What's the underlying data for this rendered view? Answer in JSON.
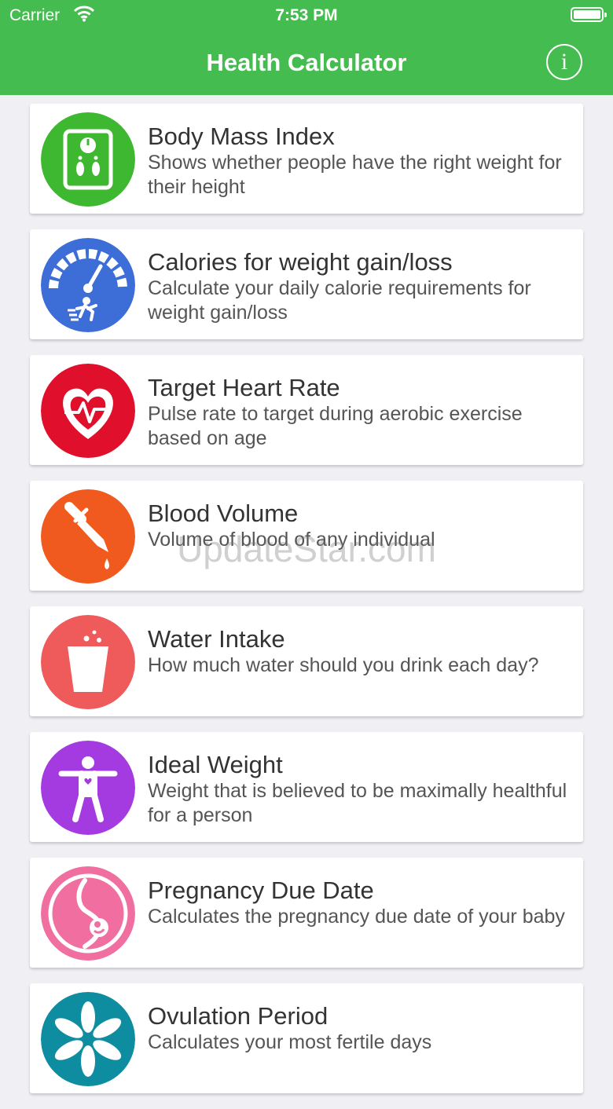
{
  "status": {
    "carrier": "Carrier",
    "time": "7:53 PM"
  },
  "header": {
    "title": "Health Calculator",
    "info_label": "i"
  },
  "items": [
    {
      "title": "Body Mass Index",
      "description": "Shows whether people have the right weight for their height",
      "color": "#3eb830",
      "icon": "scale-icon"
    },
    {
      "title": "Calories for weight gain/loss",
      "description": "Calculate your daily calorie requirements for weight gain/loss",
      "color": "#3d6ed8",
      "icon": "speedometer-runner-icon"
    },
    {
      "title": "Target Heart Rate",
      "description": "Pulse rate to target during aerobic exercise based on age",
      "color": "#e0102c",
      "icon": "heart-pulse-icon"
    },
    {
      "title": "Blood Volume",
      "description": "Volume of blood of any individual",
      "color": "#f05a1e",
      "icon": "dropper-icon"
    },
    {
      "title": "Water Intake",
      "description": "How much water should you drink each day?",
      "color": "#ef5a5a",
      "icon": "water-glass-icon"
    },
    {
      "title": "Ideal Weight",
      "description": "Weight that is believed to be maximally healthful for a person",
      "color": "#a43be0",
      "icon": "person-icon"
    },
    {
      "title": "Pregnancy Due Date",
      "description": "Calculates the pregnancy due date of your baby",
      "color": "#f06fa0",
      "icon": "pregnancy-icon"
    },
    {
      "title": "Ovulation Period",
      "description": "Calculates your most fertile days",
      "color": "#0e8ca0",
      "icon": "flower-icon"
    }
  ],
  "watermark": "UpdateStar.com"
}
